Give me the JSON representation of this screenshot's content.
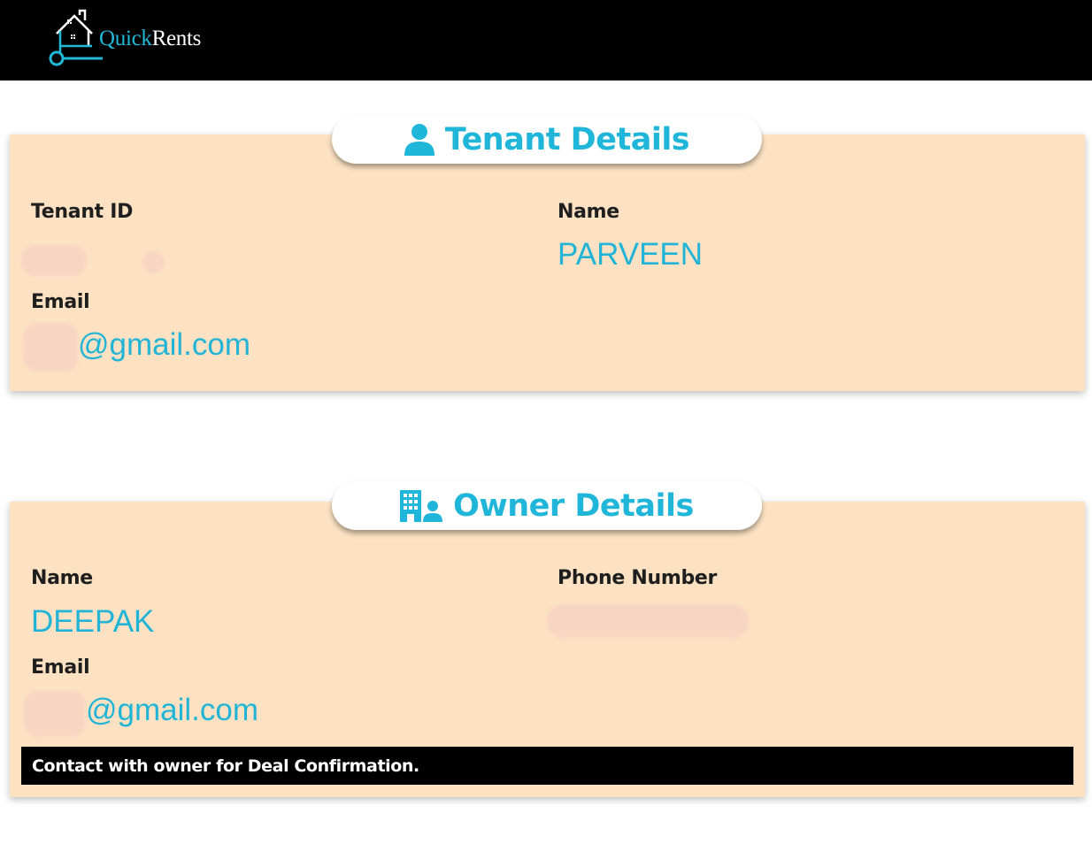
{
  "header": {
    "logo_icon": "house-key-icon",
    "brand_part1": "Quick",
    "brand_part2": "Rents",
    "colors": {
      "background": "#000000",
      "accent": "#22b8d8"
    }
  },
  "tenant": {
    "title": "Tenant Details",
    "icon": "user-icon",
    "id_label": "Tenant ID",
    "id_value": "",
    "name_label": "Name",
    "name_value": "PARVEEN",
    "email_label": "Email",
    "email_value": "@gmail.com"
  },
  "owner": {
    "title": "Owner Details",
    "icon": "building-user-icon",
    "name_label": "Name",
    "name_value": "DEEPAK",
    "phone_label": "Phone Number",
    "phone_value": "",
    "email_label": "Email",
    "email_value": "@gmail.com",
    "notice": "Contact with owner for Deal Confirmation."
  },
  "colors": {
    "card_background": "#fce2c2",
    "value_text": "#21b4d6",
    "redaction": "#f7d5c2"
  }
}
